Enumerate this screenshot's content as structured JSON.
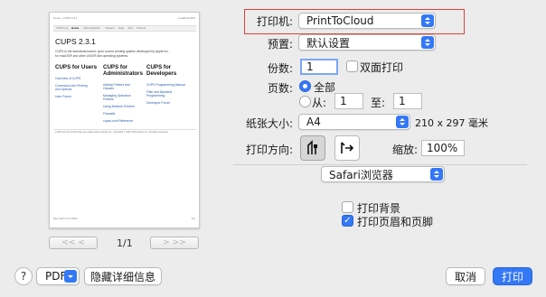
{
  "preview": {
    "header_left": "Home - CUPS 2.3.1",
    "header_right": "localhost:631/",
    "nav": [
      "CUPS.org",
      "Home",
      "Administration",
      "Classes",
      "Help",
      "Jobs",
      "Printers"
    ],
    "title": "CUPS 2.3.1",
    "intro_line1": "CUPS is the standards-based, open source printing system developed by Apple Inc.",
    "intro_line2": "for macOS® and other UNIX®-like operating systems.",
    "col1_heading": "CUPS for Users",
    "col2_heading_line1": "CUPS for",
    "col2_heading_line2": "Administrators",
    "col3_heading_line1": "CUPS for",
    "col3_heading_line2": "Developers",
    "col1_links": [
      "Overview of CUPS",
      "Command-Line Printing",
      "and Options",
      "User Forum"
    ],
    "col2_links": [
      "Adding Printers and",
      "Classes",
      "Managing Operation",
      "Policies",
      "Using Network Printers",
      "Firewalls",
      "cupsd.conf Reference"
    ],
    "col3_links": [
      "CUPS Programming Manual",
      "Filter and Backend",
      "Programming",
      "Developer Forum"
    ],
    "footer": "CUPS and the CUPS logo are trademarks of Apple Inc. Copyright © 2007-2019 Apple Inc. All rights reserved.",
    "page_footer_left": "http://127.0.0.1:631/",
    "page_footer_right": "1/1"
  },
  "pager": {
    "prev_label": "<<  <",
    "page_indicator": "1/1",
    "next_label": ">  >>"
  },
  "form": {
    "printer_label": "打印机:",
    "printer_value": "PrintToCloud",
    "preset_label": "预置:",
    "preset_value": "默认设置",
    "copies_label": "份数:",
    "copies_value": "1",
    "duplex_label": "双面打印",
    "duplex_checked": false,
    "pages_label": "页数:",
    "all_label": "全部",
    "from_label": "从:",
    "from_value": "1",
    "to_label": "至:",
    "to_value": "1",
    "paper_size_label": "纸张大小:",
    "paper_size_value": "A4",
    "paper_dims": "210 x 297 毫米",
    "orientation_label": "打印方向:",
    "scale_label": "缩放:",
    "scale_value": "100%",
    "app_section_value": "Safari浏览器",
    "print_backgrounds_label": "打印背景",
    "print_backgrounds_checked": false,
    "print_headers_label": "打印页眉和页脚",
    "print_headers_checked": true
  },
  "bottom": {
    "help_label": "?",
    "pdf_label": "PDF",
    "hide_details_label": "隐藏详细信息",
    "cancel_label": "取消",
    "print_label": "打印"
  },
  "colors": {
    "accent": "#3478f6",
    "highlight_border": "#e0403a",
    "background": "#ececec"
  },
  "icons": [
    "portrait-orientation-icon",
    "landscape-orientation-icon",
    "popup-caret-icon",
    "checkmark-icon",
    "question-mark-icon"
  ]
}
